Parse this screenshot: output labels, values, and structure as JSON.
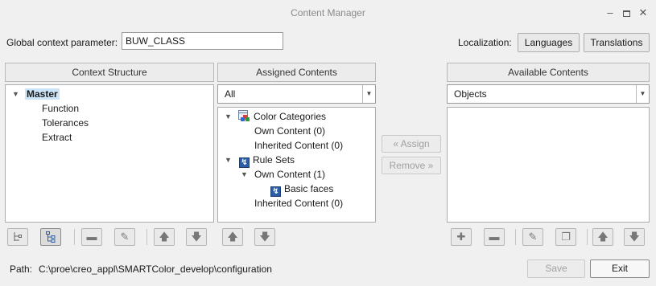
{
  "window": {
    "title": "Content Manager"
  },
  "global_context": {
    "label": "Global context parameter:",
    "value": "BUW_CLASS"
  },
  "localization": {
    "label": "Localization:",
    "languages_button": "Languages",
    "translations_button": "Translations"
  },
  "context_structure": {
    "header": "Context Structure",
    "root": "Master",
    "children": [
      "Function",
      "Tolerances",
      "Extract"
    ]
  },
  "assigned_contents": {
    "header": "Assigned Contents",
    "filter_value": "All",
    "tree": {
      "color_categories": "Color Categories",
      "cc_own": "Own Content (0)",
      "cc_inherited": "Inherited Content (0)",
      "rule_sets": "Rule Sets",
      "rs_own": "Own Content (1)",
      "rs_basic": "Basic faces",
      "rs_inherited": "Inherited Content (0)"
    }
  },
  "transfer": {
    "assign": "« Assign",
    "remove": "Remove »"
  },
  "available_contents": {
    "header": "Available Contents",
    "filter_value": "Objects"
  },
  "footer": {
    "path_label": "Path:",
    "path_value": "C:\\proe\\creo_appl\\SMARTColor_develop\\configuration",
    "save": "Save",
    "exit": "Exit"
  }
}
